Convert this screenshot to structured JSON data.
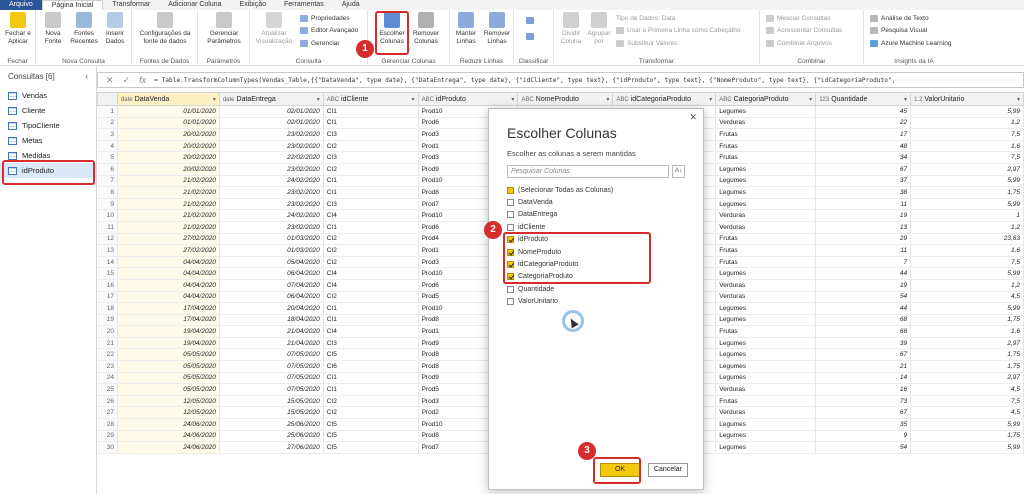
{
  "tabs": [
    "Arquivo",
    "Página Inicial",
    "Transformar",
    "Adicionar Coluna",
    "Exibição",
    "Ferramentas",
    "Ajuda"
  ],
  "ribbon": {
    "groups": {
      "fechar": {
        "label": "Fechar",
        "btn": "Fechar e Aplicar"
      },
      "nova_consulta": {
        "label": "Nova Consulta",
        "btns": [
          "Nova Fonte",
          "Fontes Recentes",
          "Inserir Dados"
        ]
      },
      "fontes": {
        "label": "Fontes de Dados",
        "btn": "Configurações da fonte de dados"
      },
      "parametros": {
        "label": "Parâmetros",
        "btn": "Gerenciar Parâmetros"
      },
      "consulta": {
        "label": "Consulta",
        "btn": "Atualizar Visualização",
        "small": [
          "Propriedades",
          "Editor Avançado",
          "Gerenciar"
        ]
      },
      "gerenciar_colunas": {
        "label": "Gerenciar Colunas",
        "btns": [
          "Escolher Colunas",
          "Remover Colunas"
        ]
      },
      "reduzir_linhas": {
        "label": "Reduzir Linhas",
        "btns": [
          "Manter Linhas",
          "Remover Linhas"
        ]
      },
      "classificar": {
        "label": "Classificar"
      },
      "transformar": {
        "label": "Transformar",
        "btns": [
          "Dividir Coluna",
          "Agrupar por"
        ],
        "small": [
          "Tipo de Dados: Data",
          "Usar a Primeira Linha como Cabeçalho",
          "Substituir Valores"
        ]
      },
      "combinar": {
        "label": "Combinar",
        "small": [
          "Mesclar Consultas",
          "Acrescentar Consultas",
          "Combinar Arquivos"
        ]
      },
      "insights": {
        "label": "Insights da IA",
        "small": [
          "Análise de Texto",
          "Pesquisa Visual",
          "Azure Machine Learning"
        ]
      }
    }
  },
  "formula": "= Table.TransformColumnTypes(Vendas_Table,{{\"DataVenda\", type date}, {\"DataEntrega\", type date}, {\"idCliente\", type text}, {\"idProduto\", type text}, {\"NomeProduto\", type text}, {\"idCategoriaProduto\",",
  "queries": {
    "header": "Consultas [6]",
    "items": [
      "Vendas",
      "Cliente",
      "TipoCliente",
      "Metas",
      "Medidas",
      "idProduto"
    ]
  },
  "grid": {
    "columns": [
      "DataVenda",
      "DataEntrega",
      "idCliente",
      "idProduto",
      "NomeProduto",
      "idCategoriaProduto",
      "CategoriaProduto",
      "Quantidade",
      "ValorUnitario"
    ],
    "col_types": [
      "date",
      "date",
      "ABC",
      "ABC",
      "ABC",
      "ABC",
      "ABC",
      "123",
      "1.2"
    ],
    "rows": [
      [
        "01/01/2020",
        "02/01/2020",
        "CI1",
        "Prod10",
        "Legumes",
        "45",
        "5,99"
      ],
      [
        "01/01/2020",
        "02/01/2020",
        "CI1",
        "Prod6",
        "Verduras",
        "22",
        "1,2"
      ],
      [
        "20/02/2020",
        "23/02/2020",
        "CI3",
        "Prod3",
        "Frutas",
        "17",
        "7,5"
      ],
      [
        "20/02/2020",
        "23/02/2020",
        "CI2",
        "Prod1",
        "Frutas",
        "48",
        "1,6"
      ],
      [
        "20/02/2020",
        "22/02/2020",
        "CI3",
        "Prod3",
        "Frutas",
        "34",
        "7,5"
      ],
      [
        "20/02/2020",
        "23/02/2020",
        "CI2",
        "Prod9",
        "Legumes",
        "67",
        "2,97"
      ],
      [
        "21/02/2020",
        "24/02/2020",
        "CI1",
        "Prod10",
        "Legumes",
        "37",
        "5,99"
      ],
      [
        "21/02/2020",
        "23/02/2020",
        "CI1",
        "Prod8",
        "Legumes",
        "38",
        "1,75"
      ],
      [
        "21/02/2020",
        "23/02/2020",
        "CI3",
        "Prod7",
        "Legumes",
        "11",
        "5,99"
      ],
      [
        "21/02/2020",
        "24/02/2020",
        "CI4",
        "Prod10",
        "Verduras",
        "19",
        "1"
      ],
      [
        "21/02/2020",
        "23/02/2020",
        "CI1",
        "Prod6",
        "Verduras",
        "13",
        "1,2"
      ],
      [
        "27/02/2020",
        "01/03/2020",
        "CI2",
        "Prod4",
        "Frutas",
        "29",
        "23,63"
      ],
      [
        "27/02/2020",
        "01/03/2020",
        "CI2",
        "Prod1",
        "Frutas",
        "11",
        "1,6"
      ],
      [
        "04/04/2020",
        "05/04/2020",
        "CI2",
        "Prod3",
        "Frutas",
        "7",
        "7,5"
      ],
      [
        "04/04/2020",
        "06/04/2020",
        "CI4",
        "Prod10",
        "Legumes",
        "44",
        "5,99"
      ],
      [
        "04/04/2020",
        "07/04/2020",
        "CI4",
        "Prod6",
        "Verduras",
        "19",
        "1,2"
      ],
      [
        "04/04/2020",
        "06/04/2020",
        "CI2",
        "Prod5",
        "Verduras",
        "54",
        "4,5"
      ],
      [
        "17/04/2020",
        "20/04/2020",
        "CI1",
        "Prod10",
        "Legumes",
        "44",
        "5,99"
      ],
      [
        "17/04/2020",
        "18/04/2020",
        "CI1",
        "Prod8",
        "Legumes",
        "68",
        "1,75"
      ],
      [
        "19/04/2020",
        "21/04/2020",
        "CI4",
        "Prod1",
        "Frutas",
        "68",
        "1,6"
      ],
      [
        "19/04/2020",
        "21/04/2020",
        "CI3",
        "Prod9",
        "Legumes",
        "39",
        "2,97"
      ],
      [
        "05/05/2020",
        "07/05/2020",
        "CI5",
        "Prod8",
        "Legumes",
        "67",
        "1,75"
      ],
      [
        "05/05/2020",
        "07/05/2020",
        "CI6",
        "Prod8",
        "Legumes",
        "21",
        "1,75"
      ],
      [
        "05/05/2020",
        "07/05/2020",
        "CI1",
        "Prod9",
        "Legumes",
        "14",
        "2,97"
      ],
      [
        "05/05/2020",
        "07/05/2020",
        "CI1",
        "Prod5",
        "Verduras",
        "16",
        "4,5"
      ],
      [
        "12/05/2020",
        "15/05/2020",
        "CI2",
        "Prod3",
        "Frutas",
        "73",
        "7,5"
      ],
      [
        "12/05/2020",
        "15/05/2020",
        "CI2",
        "Prod2",
        "Verduras",
        "67",
        "4,5"
      ],
      [
        "24/06/2020",
        "25/06/2020",
        "CI5",
        "Prod10",
        "Legumes",
        "35",
        "5,99"
      ],
      [
        "24/06/2020",
        "25/06/2020",
        "CI5",
        "Prod8",
        "Legumes",
        "9",
        "1,75"
      ],
      [
        "24/06/2020",
        "27/06/2020",
        "CI5",
        "Prod7",
        "Legumes",
        "54",
        "5,99"
      ]
    ]
  },
  "dialog": {
    "title": "Escolher Colunas",
    "subtitle": "Escolher as colunas a serem mantidas",
    "search_placeholder": "Pesquisar Colunas",
    "select_all": "(Selecionar Todas as Colunas)",
    "items": [
      {
        "label": "DataVenda",
        "checked": false
      },
      {
        "label": "DataEntrega",
        "checked": false
      },
      {
        "label": "idCliente",
        "checked": false
      },
      {
        "label": "idProduto",
        "checked": true
      },
      {
        "label": "NomeProduto",
        "checked": true
      },
      {
        "label": "idCategoriaProduto",
        "checked": true
      },
      {
        "label": "CategoriaProduto",
        "checked": true
      },
      {
        "label": "Quantidade",
        "checked": false
      },
      {
        "label": "ValorUnitario",
        "checked": false
      }
    ],
    "ok": "OK",
    "cancel": "Cancelar"
  },
  "callouts": [
    "1",
    "2",
    "3"
  ],
  "colors": {
    "accent": "#f2c811",
    "highlight": "#d62c2c",
    "file_tab": "#2b579a"
  }
}
